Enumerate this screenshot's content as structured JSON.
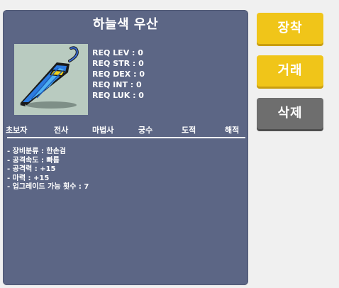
{
  "item": {
    "name": "하늘색 우산",
    "icon": "blue-umbrella-icon"
  },
  "requirements": {
    "lev": "REQ LEV : 0",
    "str": "REQ STR : 0",
    "dex": "REQ DEX : 0",
    "int": "REQ INT : 0",
    "luk": "REQ LUK : 0"
  },
  "jobs": [
    "초보자",
    "전사",
    "마법사",
    "궁수",
    "도적",
    "해적"
  ],
  "stats": {
    "category": "- 장비분류 : 한손검",
    "attack_speed": "- 공격속도 : 빠름",
    "attack": "- 공격력 : +15",
    "magic": "- 마력 : +15",
    "upgrades": "- 업그레이드 가능 횟수 : 7"
  },
  "buttons": {
    "equip": "장착",
    "trade": "거래",
    "delete": "삭제"
  },
  "colors": {
    "panel": "#5c6685",
    "accent": "#f0c519",
    "disabled": "#6e6e6e"
  }
}
